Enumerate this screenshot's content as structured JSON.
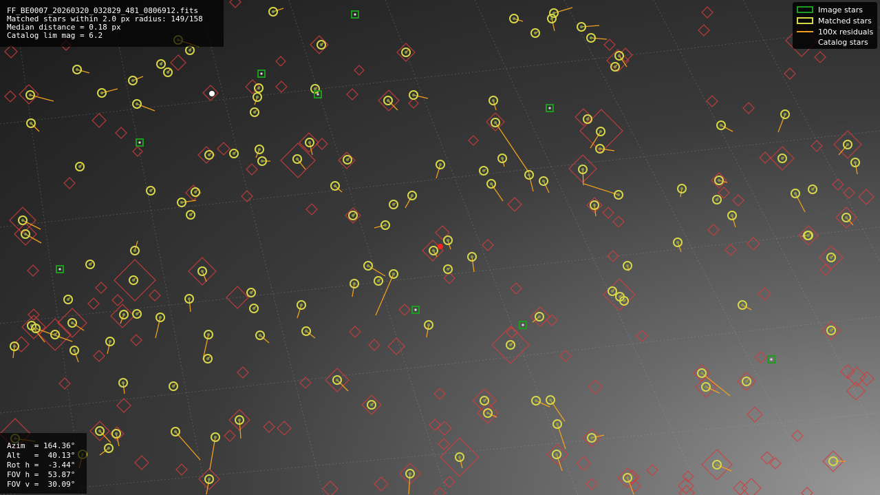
{
  "info_top": {
    "lines": [
      "FF_BE0007_20260320_032829_481_0806912.fits",
      "Matched stars within 2.0 px radius: 149/158",
      "Median distance = 0.18 px",
      "Catalog lim mag = 6.2"
    ]
  },
  "info_bottom": {
    "lines": [
      "Azim  = 164.36°",
      "Alt   =  40.13°",
      "Rot h =  -3.44°",
      "FOV h =  53.87°",
      "FOV v =  30.09°"
    ]
  },
  "legend": {
    "items": [
      {
        "label": "Image stars",
        "symbol": "green-square"
      },
      {
        "label": "Matched stars",
        "symbol": "yellow-circle"
      },
      {
        "label": "100x residuals",
        "symbol": "orange-line"
      },
      {
        "label": "Catalog stars",
        "symbol": "red-diamond"
      }
    ]
  },
  "colors": {
    "image_star": "#1e9a1e",
    "matched_star": "#d7d74a",
    "matched_star_inner": "#8aa046",
    "residual": "#f0a020",
    "catalog_star": "#d23c3c"
  },
  "stars": {
    "matched": [
      [
        397,
        17,
        412,
        12
      ],
      [
        747,
        27,
        760,
        31
      ],
      [
        805,
        19,
        832,
        11
      ],
      [
        802,
        27,
        806,
        45
      ],
      [
        778,
        48,
        782,
        46
      ],
      [
        845,
        39,
        871,
        37
      ],
      [
        859,
        55,
        882,
        57
      ],
      [
        900,
        81,
        911,
        97
      ],
      [
        894,
        97,
        897,
        94
      ],
      [
        467,
        65,
        470,
        62
      ],
      [
        590,
        76,
        593,
        73
      ],
      [
        259,
        58,
        289,
        68
      ],
      [
        276,
        73,
        278,
        70
      ],
      [
        234,
        93,
        236,
        90
      ],
      [
        244,
        105,
        247,
        101
      ],
      [
        112,
        101,
        130,
        106
      ],
      [
        193,
        117,
        208,
        111
      ],
      [
        148,
        135,
        171,
        129
      ],
      [
        44,
        138,
        78,
        147
      ],
      [
        199,
        151,
        225,
        161
      ],
      [
        376,
        128,
        378,
        126
      ],
      [
        374,
        141,
        370,
        152
      ],
      [
        370,
        163,
        373,
        160
      ],
      [
        458,
        129,
        461,
        127
      ],
      [
        564,
        146,
        578,
        160
      ],
      [
        601,
        138,
        622,
        143
      ],
      [
        717,
        146,
        721,
        160
      ],
      [
        45,
        179,
        57,
        191
      ],
      [
        720,
        178,
        769,
        251
      ],
      [
        854,
        173,
        856,
        170
      ],
      [
        873,
        191,
        858,
        215
      ],
      [
        872,
        216,
        893,
        219
      ],
      [
        1048,
        182,
        1065,
        191
      ],
      [
        1141,
        166,
        1131,
        192
      ],
      [
        450,
        207,
        454,
        225
      ],
      [
        505,
        232,
        508,
        229
      ],
      [
        377,
        217,
        372,
        229
      ],
      [
        381,
        234,
        393,
        234
      ],
      [
        432,
        231,
        444,
        246
      ],
      [
        340,
        223,
        343,
        220
      ],
      [
        304,
        225,
        307,
        222
      ],
      [
        116,
        242,
        119,
        239
      ],
      [
        640,
        239,
        634,
        259
      ],
      [
        703,
        248,
        706,
        246
      ],
      [
        730,
        230,
        733,
        242
      ],
      [
        769,
        254,
        775,
        278
      ],
      [
        847,
        246,
        848,
        269
      ],
      [
        790,
        263,
        798,
        280
      ],
      [
        899,
        283,
        849,
        267
      ],
      [
        714,
        267,
        731,
        292
      ],
      [
        1232,
        210,
        1219,
        225
      ],
      [
        1243,
        236,
        1246,
        253
      ],
      [
        1137,
        230,
        1140,
        228
      ],
      [
        991,
        274,
        989,
        286
      ],
      [
        1045,
        262,
        1057,
        265
      ],
      [
        1042,
        290,
        1044,
        287
      ],
      [
        1064,
        313,
        1069,
        330
      ],
      [
        1156,
        281,
        1170,
        308
      ],
      [
        1181,
        275,
        1184,
        272
      ],
      [
        1230,
        316,
        1240,
        327
      ],
      [
        1175,
        342,
        1165,
        343
      ],
      [
        219,
        277,
        222,
        274
      ],
      [
        284,
        279,
        287,
        276
      ],
      [
        264,
        294,
        285,
        291
      ],
      [
        277,
        312,
        280,
        309
      ],
      [
        487,
        270,
        497,
        279
      ],
      [
        572,
        297,
        575,
        295
      ],
      [
        599,
        284,
        589,
        302
      ],
      [
        513,
        313,
        516,
        310
      ],
      [
        560,
        327,
        544,
        331
      ],
      [
        33,
        320,
        59,
        333
      ],
      [
        37,
        340,
        60,
        353
      ],
      [
        651,
        349,
        655,
        362
      ],
      [
        630,
        364,
        635,
        373
      ],
      [
        686,
        373,
        689,
        395
      ],
      [
        651,
        391,
        654,
        389
      ],
      [
        864,
        298,
        866,
        314
      ],
      [
        985,
        352,
        990,
        366
      ],
      [
        196,
        364,
        200,
        350
      ],
      [
        131,
        384,
        134,
        381
      ],
      [
        294,
        394,
        300,
        409
      ],
      [
        194,
        407,
        197,
        404
      ],
      [
        535,
        386,
        560,
        401
      ],
      [
        515,
        412,
        512,
        431
      ],
      [
        550,
        408,
        553,
        405
      ],
      [
        572,
        398,
        546,
        458
      ],
      [
        1208,
        374,
        1211,
        371
      ],
      [
        1174,
        342,
        1177,
        339
      ],
      [
        912,
        386,
        914,
        394
      ],
      [
        890,
        423,
        893,
        420
      ],
      [
        901,
        431,
        904,
        428
      ],
      [
        907,
        437,
        910,
        435
      ],
      [
        1079,
        443,
        1092,
        450
      ],
      [
        365,
        425,
        368,
        422
      ],
      [
        369,
        448,
        372,
        445
      ],
      [
        438,
        443,
        432,
        462
      ],
      [
        99,
        435,
        102,
        432
      ],
      [
        275,
        434,
        277,
        453
      ],
      [
        180,
        457,
        175,
        470
      ],
      [
        199,
        456,
        203,
        453
      ],
      [
        233,
        461,
        226,
        491
      ],
      [
        105,
        469,
        122,
        480
      ],
      [
        46,
        473,
        65,
        497
      ],
      [
        52,
        477,
        105,
        496
      ],
      [
        80,
        486,
        83,
        483
      ],
      [
        21,
        503,
        19,
        520
      ],
      [
        108,
        509,
        114,
        526
      ],
      [
        160,
        496,
        156,
        514
      ],
      [
        303,
        486,
        295,
        522
      ],
      [
        302,
        521,
        305,
        518
      ],
      [
        378,
        487,
        391,
        498
      ],
      [
        445,
        481,
        458,
        491
      ],
      [
        623,
        472,
        620,
        490
      ],
      [
        784,
        460,
        774,
        468
      ],
      [
        742,
        501,
        745,
        498
      ],
      [
        1208,
        480,
        1211,
        477
      ],
      [
        1020,
        542,
        1061,
        575
      ],
      [
        1026,
        562,
        1046,
        571
      ],
      [
        1085,
        554,
        1088,
        551
      ],
      [
        490,
        552,
        506,
        568
      ],
      [
        540,
        588,
        543,
        585
      ],
      [
        704,
        582,
        707,
        579
      ],
      [
        709,
        600,
        722,
        606
      ],
      [
        779,
        582,
        799,
        591
      ],
      [
        800,
        581,
        821,
        612
      ],
      [
        810,
        616,
        822,
        652
      ],
      [
        179,
        556,
        181,
        572
      ],
      [
        252,
        561,
        255,
        558
      ],
      [
        348,
        610,
        350,
        637
      ],
      [
        145,
        626,
        161,
        643
      ],
      [
        169,
        630,
        173,
        648
      ],
      [
        255,
        627,
        291,
        668
      ],
      [
        313,
        635,
        305,
        682
      ],
      [
        158,
        651,
        145,
        661
      ],
      [
        120,
        660,
        115,
        680
      ],
      [
        22,
        637,
        51,
        641
      ],
      [
        304,
        696,
        300,
        718
      ],
      [
        596,
        688,
        594,
        718
      ],
      [
        668,
        664,
        672,
        680
      ],
      [
        809,
        660,
        817,
        684
      ],
      [
        860,
        636,
        878,
        632
      ],
      [
        912,
        694,
        921,
        718
      ],
      [
        1042,
        675,
        1063,
        684
      ],
      [
        1211,
        670,
        1229,
        670
      ]
    ],
    "image": [
      [
        516,
        21
      ],
      [
        380,
        107
      ],
      [
        462,
        137
      ],
      [
        203,
        207
      ],
      [
        799,
        157
      ],
      [
        87,
        391
      ],
      [
        604,
        450
      ],
      [
        760,
        472
      ],
      [
        1121,
        522
      ]
    ],
    "catalog": [
      [
        342,
        3,
        8
      ],
      [
        16,
        75,
        9
      ],
      [
        96,
        66,
        7
      ],
      [
        408,
        89,
        7
      ],
      [
        522,
        102,
        7
      ],
      [
        259,
        91,
        11
      ],
      [
        367,
        126,
        10
      ],
      [
        409,
        126,
        8
      ],
      [
        512,
        137,
        8
      ],
      [
        565,
        146,
        15
      ],
      [
        601,
        150,
        7
      ],
      [
        42,
        137,
        14
      ],
      [
        15,
        140,
        8
      ],
      [
        144,
        175,
        10
      ],
      [
        176,
        193,
        8
      ],
      [
        200,
        220,
        7
      ],
      [
        306,
        135,
        11
      ],
      [
        325,
        216,
        9
      ],
      [
        300,
        225,
        12
      ],
      [
        468,
        209,
        8
      ],
      [
        433,
        233,
        25
      ],
      [
        449,
        207,
        14
      ],
      [
        504,
        233,
        12
      ],
      [
        366,
        246,
        8
      ],
      [
        464,
        65,
        13
      ],
      [
        590,
        76,
        13
      ],
      [
        688,
        204,
        7
      ],
      [
        720,
        177,
        13
      ],
      [
        848,
        170,
        12
      ],
      [
        874,
        190,
        31
      ],
      [
        847,
        245,
        20
      ],
      [
        748,
        297,
        10
      ],
      [
        864,
        298,
        11
      ],
      [
        884,
        309,
        8
      ],
      [
        899,
        322,
        8
      ],
      [
        886,
        65,
        8
      ],
      [
        909,
        80,
        10
      ],
      [
        898,
        88,
        16
      ],
      [
        1028,
        18,
        8
      ],
      [
        1023,
        44,
        8
      ],
      [
        1165,
        59,
        23
      ],
      [
        1192,
        83,
        8
      ],
      [
        1148,
        107,
        8
      ],
      [
        1035,
        147,
        8
      ],
      [
        1088,
        157,
        8
      ],
      [
        1187,
        212,
        8
      ],
      [
        1232,
        210,
        20
      ],
      [
        1112,
        229,
        8
      ],
      [
        1137,
        230,
        17
      ],
      [
        1218,
        268,
        8
      ],
      [
        1234,
        280,
        8
      ],
      [
        1259,
        286,
        11
      ],
      [
        1045,
        262,
        11
      ],
      [
        1073,
        291,
        8
      ],
      [
        1052,
        280,
        8
      ],
      [
        1037,
        334,
        8
      ],
      [
        1062,
        363,
        8
      ],
      [
        1095,
        354,
        9
      ],
      [
        1175,
        342,
        14
      ],
      [
        1230,
        316,
        15
      ],
      [
        1208,
        374,
        17
      ],
      [
        1200,
        392,
        8
      ],
      [
        1111,
        427,
        9
      ],
      [
        1208,
        480,
        13
      ],
      [
        1106,
        519,
        8
      ],
      [
        1232,
        540,
        10
      ],
      [
        1245,
        547,
        14
      ],
      [
        1260,
        550,
        10
      ],
      [
        1244,
        568,
        13
      ],
      [
        1097,
        602,
        11
      ],
      [
        1159,
        633,
        8
      ],
      [
        1115,
        665,
        9
      ],
      [
        1127,
        673,
        8
      ],
      [
        1042,
        675,
        22
      ],
      [
        1211,
        670,
        15
      ],
      [
        1000,
        692,
        8
      ],
      [
        997,
        706,
        11
      ],
      [
        1076,
        709,
        10
      ],
      [
        1092,
        709,
        14
      ],
      [
        1173,
        716,
        8
      ],
      [
        101,
        266,
        8
      ],
      [
        281,
        280,
        11
      ],
      [
        359,
        285,
        8
      ],
      [
        453,
        304,
        8
      ],
      [
        513,
        313,
        11
      ],
      [
        33,
        320,
        19
      ],
      [
        37,
        340,
        16
      ],
      [
        629,
        364,
        15
      ],
      [
        643,
        338,
        10
      ],
      [
        709,
        356,
        8
      ],
      [
        653,
        404,
        8
      ],
      [
        891,
        372,
        8
      ],
      [
        750,
        419,
        8
      ],
      [
        900,
        428,
        23
      ],
      [
        933,
        488,
        8
      ],
      [
        822,
        517,
        8
      ],
      [
        48,
        393,
        8
      ],
      [
        196,
        407,
        30
      ],
      [
        294,
        394,
        20
      ],
      [
        345,
        432,
        16
      ],
      [
        225,
        429,
        8
      ],
      [
        171,
        436,
        8
      ],
      [
        136,
        441,
        8
      ],
      [
        147,
        418,
        8
      ],
      [
        49,
        457,
        8
      ],
      [
        178,
        459,
        17
      ],
      [
        105,
        469,
        21
      ],
      [
        49,
        475,
        17
      ],
      [
        80,
        486,
        23
      ],
      [
        31,
        500,
        11
      ],
      [
        144,
        517,
        8
      ],
      [
        198,
        494,
        8
      ],
      [
        588,
        450,
        8
      ],
      [
        744,
        483,
        8
      ],
      [
        785,
        460,
        14
      ],
      [
        802,
        465,
        8
      ],
      [
        742,
        501,
        27
      ],
      [
        576,
        503,
        12
      ],
      [
        544,
        501,
        8
      ],
      [
        516,
        482,
        8
      ],
      [
        353,
        541,
        8
      ],
      [
        94,
        557,
        8
      ],
      [
        180,
        589,
        10
      ],
      [
        444,
        556,
        8
      ],
      [
        490,
        552,
        17
      ],
      [
        540,
        588,
        14
      ],
      [
        639,
        572,
        8
      ],
      [
        865,
        562,
        10
      ],
      [
        704,
        582,
        17
      ],
      [
        709,
        600,
        15
      ],
      [
        1020,
        542,
        12
      ],
      [
        1026,
        562,
        15
      ],
      [
        1085,
        554,
        13
      ],
      [
        348,
        610,
        15
      ],
      [
        413,
        622,
        10
      ],
      [
        391,
        620,
        8
      ],
      [
        334,
        633,
        8
      ],
      [
        145,
        626,
        14
      ],
      [
        170,
        630,
        10
      ],
      [
        22,
        630,
        22
      ],
      [
        206,
        672,
        10
      ],
      [
        264,
        682,
        8
      ],
      [
        304,
        696,
        15
      ],
      [
        480,
        710,
        11
      ],
      [
        554,
        703,
        10
      ],
      [
        596,
        688,
        15
      ],
      [
        632,
        617,
        8
      ],
      [
        646,
        622,
        10
      ],
      [
        645,
        645,
        8
      ],
      [
        668,
        664,
        28
      ],
      [
        653,
        700,
        8
      ],
      [
        810,
        660,
        15
      ],
      [
        860,
        636,
        13
      ],
      [
        848,
        673,
        10
      ],
      [
        860,
        703,
        8
      ],
      [
        912,
        694,
        14
      ],
      [
        923,
        706,
        8
      ],
      [
        948,
        683,
        8
      ],
      [
        919,
        693,
        10
      ],
      [
        998,
        716,
        11
      ],
      [
        639,
        716,
        8
      ]
    ]
  }
}
